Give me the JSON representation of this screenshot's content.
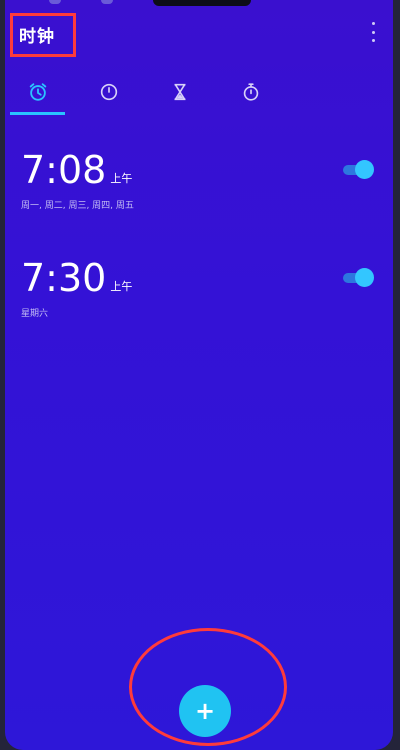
{
  "app": {
    "title": "时钟"
  },
  "tabs": [
    {
      "name": "alarm",
      "icon": "alarm-clock-icon",
      "active": true
    },
    {
      "name": "clock",
      "icon": "clock-icon",
      "active": false
    },
    {
      "name": "timer",
      "icon": "hourglass-icon",
      "active": false
    },
    {
      "name": "stopwatch",
      "icon": "stopwatch-icon",
      "active": false
    }
  ],
  "alarms": [
    {
      "time": "7:08",
      "ampm": "上午",
      "days": "周一, 周二, 周三, 周四, 周五",
      "enabled": true
    },
    {
      "time": "7:30",
      "ampm": "上午",
      "days": "星期六",
      "enabled": true
    }
  ],
  "fab": {
    "label": "+"
  },
  "colors": {
    "background": "#3414d4",
    "accent": "#2ac3ff",
    "highlight": "#ff3b3b"
  }
}
